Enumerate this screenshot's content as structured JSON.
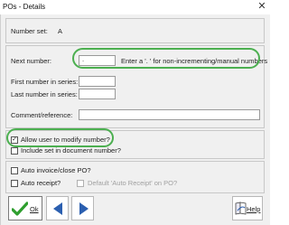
{
  "window": {
    "title": "POs - Details",
    "close_glyph": "✕"
  },
  "number_set": {
    "label": "Number set:",
    "value": "A"
  },
  "next_number": {
    "label": "Next number:",
    "value": ".",
    "hint": "Enter a '. ' for non-incrementing/manual numbers"
  },
  "first_number": {
    "label": "First number in series:",
    "value": ""
  },
  "last_number": {
    "label": "Last number in series:",
    "value": ""
  },
  "comment": {
    "label": "Comment/reference:",
    "value": ""
  },
  "allow_modify": {
    "label": "Allow user to modify number?",
    "checked": true
  },
  "include_set": {
    "label": "Include set in document number?",
    "checked": false
  },
  "auto_invoice": {
    "label": "Auto invoice/close PO?",
    "checked": false
  },
  "auto_receipt": {
    "label": "Auto receipt?",
    "checked": false
  },
  "default_receipt": {
    "label": "Default 'Auto Receipt' on PO?",
    "checked": false
  },
  "buttons": {
    "ok": "Ok",
    "prev": "previous-record",
    "next": "next-record",
    "help": "Help"
  },
  "colors": {
    "highlight": "#4caf50",
    "ok_check": "#2e9e2e",
    "arrow": "#2b5fb0"
  }
}
